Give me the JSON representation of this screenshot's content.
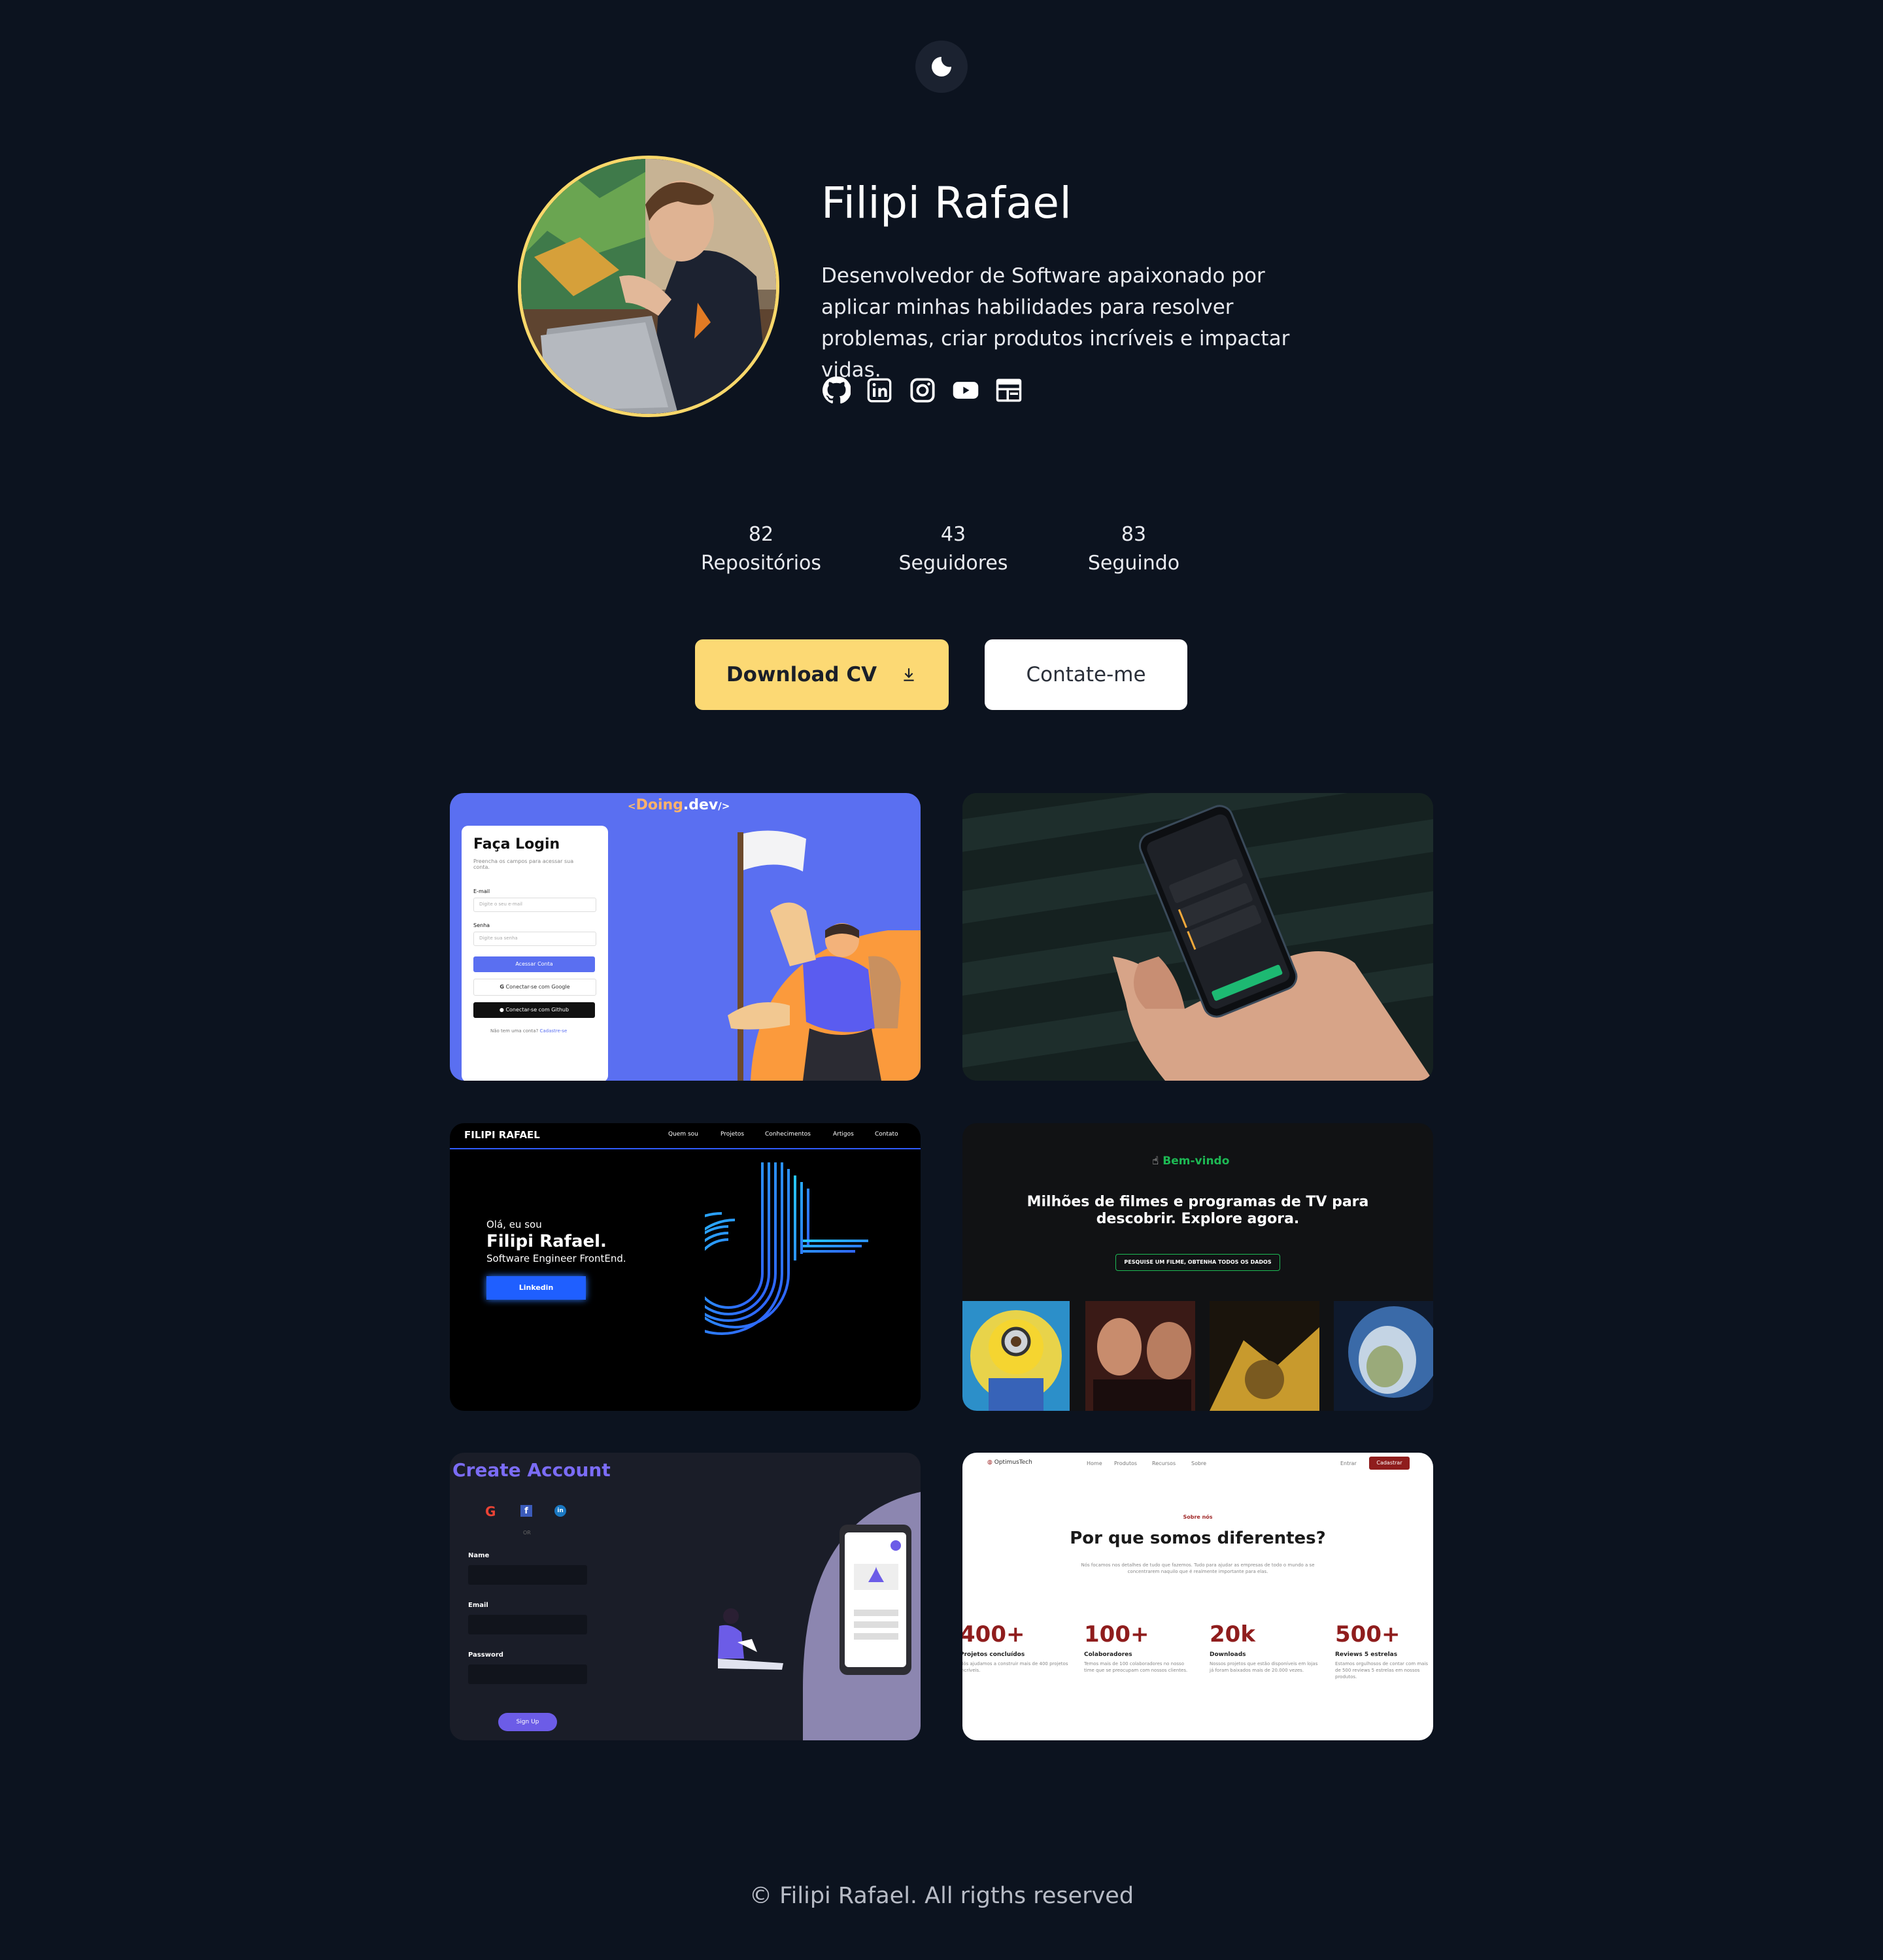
{
  "theme_toggle": {
    "icon": "moon-icon"
  },
  "profile": {
    "name": "Filipi Rafael",
    "bio": "Desenvolvedor de Software apaixonado por aplicar minhas habilidades para resolver problemas, criar produtos incríveis e impactar vidas.",
    "socials": [
      "github-icon",
      "linkedin-icon",
      "instagram-icon",
      "youtube-icon",
      "website-icon"
    ]
  },
  "stats": [
    {
      "value": "82",
      "label": "Repositórios"
    },
    {
      "value": "43",
      "label": "Seguidores"
    },
    {
      "value": "83",
      "label": "Seguindo"
    }
  ],
  "buttons": {
    "download": "Download CV",
    "contact": "Contate-me"
  },
  "projects": {
    "p1": {
      "brand_prefix": "<",
      "brand_main": "Doing",
      "brand_dev": ".dev",
      "brand_suffix": "/>",
      "title": "Faça Login",
      "subtitle": "Preencha os campos para acessar sua conta.",
      "email_label": "E-mail",
      "email_placeholder": "Digite o seu e-mail",
      "password_label": "Senha",
      "password_placeholder": "Digite sua senha",
      "submit": "Acessar Conta",
      "google": "Conectar-se com Google",
      "github": "Conectar-se com Github",
      "footer": "Não tem uma conta?",
      "footer_link": "Cadastre-se"
    },
    "p2": {},
    "p3": {
      "logo": "FILIPI RAFAEL",
      "nav": [
        "Quem sou",
        "Projetos",
        "Conhecimentos",
        "Artigos",
        "Contato"
      ],
      "intro": "Olá, eu sou",
      "name": "Filipi Rafael.",
      "role": "Software Engineer FrontEnd.",
      "button": "Linkedin"
    },
    "p4": {
      "welcome": "Bem-vindo",
      "headline_1": "Milhões de filmes e programas de TV para",
      "headline_2": "descobrir. Explore agora.",
      "search": "PESQUISE UM FILME, OBTENHA TODOS OS DADOS"
    },
    "p5": {
      "title": "Create Account",
      "or": "OR",
      "name_label": "Name",
      "email_label": "Email",
      "password_label": "Password",
      "button": "Sign Up"
    },
    "p6": {
      "logo": "OptimusTech",
      "nav": [
        "Home",
        "Produtos",
        "Recursos",
        "Sobre"
      ],
      "login": "Entrar",
      "signup": "Cadastrar",
      "eyebrow": "Sobre nós",
      "title": "Por que somos diferentes?",
      "desc_1": "Nós focamos nos detalhes de tudo que fazemos. Tudo para ajudar as empresas de todo o mundo a se",
      "desc_2": "concentrarem naquilo que é realmente importante para elas.",
      "stats": [
        {
          "value": "400+",
          "label": "Projetos concluídos",
          "desc": "Nós ajudamos a construir mais de 400 projetos incríveis."
        },
        {
          "value": "100+",
          "label": "Colaboradores",
          "desc": "Temos mais de 100 colaboradores no nosso time que se preocupam com nossos clientes."
        },
        {
          "value": "20k",
          "label": "Downloads",
          "desc": "Nossos projetos que estão disponíveis em lojas já foram baixados mais de 20.000 vezes."
        },
        {
          "value": "500+",
          "label": "Reviews 5 estrelas",
          "desc": "Estamos orgulhosos de contar com mais de 500 reviews 5 estrelas em nossos produtos."
        }
      ]
    }
  },
  "footer": "© Filipi Rafael. All rigths reserved",
  "colors": {
    "background": "#0c131f",
    "accent": "#fcd974",
    "card_blue": "#5a6ff1",
    "green": "#1db954",
    "red": "#8f1d1d"
  }
}
